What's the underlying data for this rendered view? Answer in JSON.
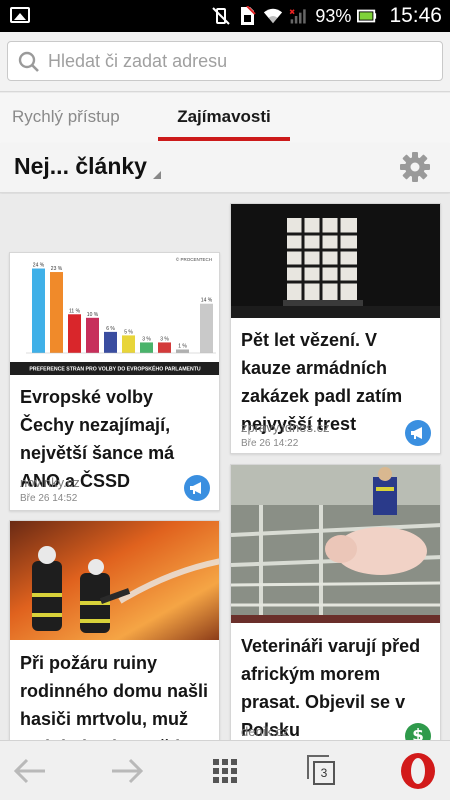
{
  "status_bar": {
    "battery": "93%",
    "time": "15:46",
    "icons": [
      "gallery-icon",
      "vibrate-off-icon",
      "sim-icon",
      "wifi-icon",
      "signal-icon",
      "battery-icon"
    ]
  },
  "address_bar": {
    "placeholder": "Hledat či zadat adresu",
    "value": ""
  },
  "tabs": [
    {
      "label": "Rychlý přístup",
      "active": false
    },
    {
      "label": "Zajímavosti",
      "active": true
    }
  ],
  "colors": {
    "accent": "#cc1a1a",
    "badge_blue": "#3a8fe0",
    "badge_green": "#2f9a4b"
  },
  "section": {
    "title": "Nej... články"
  },
  "articles": [
    {
      "headline": "Evropské volby Čechy nezajímají, největší šance má ANO a ČSSD",
      "source": "novinky.cz",
      "date": "Bře 26 14:52",
      "badge": "megaphone-icon",
      "image": {
        "type": "chart",
        "caption": "PREFERENCE STRAN PRO VOLBY DO EVROPSKÉHO PARLAMENTU",
        "brand": "© PROCENTECH",
        "bar_labels": [
          "24 %",
          "23 %",
          "11 %",
          "10 %",
          "6 %",
          "5 %",
          "3 %",
          "3 %",
          "1 %",
          "14 %"
        ],
        "bar_values": [
          24,
          23,
          11,
          10,
          6,
          5,
          3,
          3,
          1,
          14
        ],
        "bar_colors": [
          "#3fb0e8",
          "#f08a2a",
          "#d9262b",
          "#c72f5b",
          "#3a4da0",
          "#e8d53a",
          "#4ab36b",
          "#d33a3a",
          "#b0b0b0",
          "#c9c9c9"
        ]
      }
    },
    {
      "headline": "Pět let vězení. V kauze armádních zakázek padl zatím nejvyšší trest",
      "source": "zpravy.idnes.cz",
      "date": "Bře 26 14:22",
      "badge": "megaphone-icon",
      "image": {
        "type": "photo",
        "subject": "barred-window"
      }
    },
    {
      "headline": "Při požáru ruiny rodinného domu našli hasiči mrtvolu, muž spáchal sebevraždu",
      "source": "",
      "date": "",
      "badge": "",
      "image": {
        "type": "photo",
        "subject": "firefighters"
      }
    },
    {
      "headline": "Veterináři varují před africkým morem prasat. Objevil se v Polsku",
      "source": "denik.cz",
      "date": "",
      "badge": "dollar-icon",
      "image": {
        "type": "photo",
        "subject": "pig-farm"
      }
    }
  ],
  "bottom_bar": {
    "tab_count": "3",
    "buttons": [
      "back-arrow-icon",
      "forward-arrow-icon",
      "speed-dial-grid-icon",
      "tabs-icon",
      "opera-menu-icon"
    ]
  }
}
